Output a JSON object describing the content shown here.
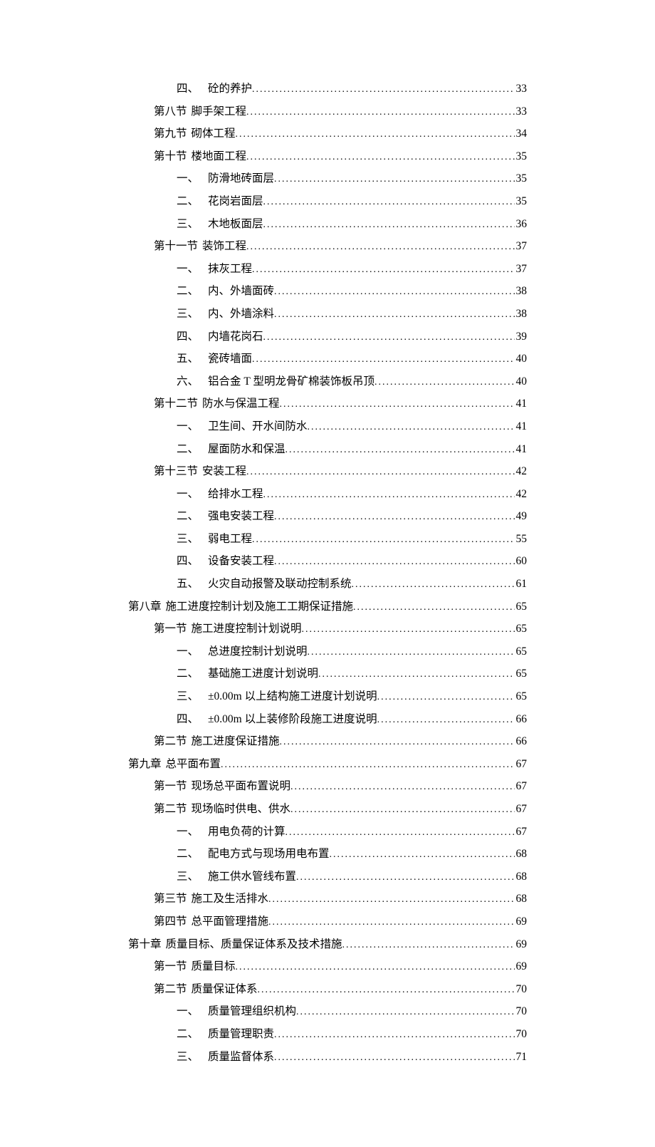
{
  "toc": [
    {
      "level": 2,
      "label": "四、",
      "title": "砼的养护",
      "page": "33"
    },
    {
      "level": 1,
      "label": "第八节",
      "title": "脚手架工程",
      "page": "33"
    },
    {
      "level": 1,
      "label": "第九节",
      "title": "砌体工程",
      "page": "34"
    },
    {
      "level": 1,
      "label": "第十节",
      "title": "楼地面工程",
      "page": "35"
    },
    {
      "level": 2,
      "label": "一、",
      "title": "防滑地砖面层",
      "page": "35"
    },
    {
      "level": 2,
      "label": "二、",
      "title": "花岗岩面层",
      "page": "35"
    },
    {
      "level": 2,
      "label": "三、",
      "title": "木地板面层",
      "page": "36"
    },
    {
      "level": 1,
      "label": "第十一节",
      "title": "装饰工程",
      "page": "37"
    },
    {
      "level": 2,
      "label": "一、",
      "title": "抹灰工程",
      "page": "37"
    },
    {
      "level": 2,
      "label": "二、",
      "title": "内、外墙面砖",
      "page": "38"
    },
    {
      "level": 2,
      "label": "三、",
      "title": "内、外墙涂料",
      "page": "38"
    },
    {
      "level": 2,
      "label": "四、",
      "title": "内墙花岗石",
      "page": "39"
    },
    {
      "level": 2,
      "label": "五、",
      "title": "瓷砖墙面",
      "page": "40"
    },
    {
      "level": 2,
      "label": "六、",
      "title": "铝合金 T 型明龙骨矿棉装饰板吊顶",
      "page": "40"
    },
    {
      "level": 1,
      "label": "第十二节",
      "title": "防水与保温工程",
      "page": "41"
    },
    {
      "level": 2,
      "label": "一、",
      "title": "卫生间、开水间防水",
      "page": "41"
    },
    {
      "level": 2,
      "label": "二、",
      "title": "屋面防水和保温",
      "page": "41"
    },
    {
      "level": 1,
      "label": "第十三节",
      "title": "安装工程",
      "page": "42"
    },
    {
      "level": 2,
      "label": "一、",
      "title": "给排水工程",
      "page": "42"
    },
    {
      "level": 2,
      "label": "二、",
      "title": "强电安装工程",
      "page": "49"
    },
    {
      "level": 2,
      "label": "三、",
      "title": "弱电工程",
      "page": "55"
    },
    {
      "level": 2,
      "label": "四、",
      "title": "设备安装工程",
      "page": "60"
    },
    {
      "level": 2,
      "label": "五、",
      "title": "火灾自动报警及联动控制系统",
      "page": "61"
    },
    {
      "level": 0,
      "label": "第八章",
      "title": "施工进度控制计划及施工工期保证措施",
      "page": "65"
    },
    {
      "level": 1,
      "label": "第一节",
      "title": "施工进度控制计划说明",
      "page": "65"
    },
    {
      "level": 2,
      "label": "一、",
      "title": "总进度控制计划说明",
      "page": "65"
    },
    {
      "level": 2,
      "label": "二、",
      "title": "基础施工进度计划说明",
      "page": "65"
    },
    {
      "level": 2,
      "label": "三、",
      "title": "±0.00m 以上结构施工进度计划说明",
      "page": "65"
    },
    {
      "level": 2,
      "label": "四、",
      "title": "±0.00m 以上装修阶段施工进度说明",
      "page": "66"
    },
    {
      "level": 1,
      "label": "第二节",
      "title": "施工进度保证措施",
      "page": "66"
    },
    {
      "level": 0,
      "label": "第九章",
      "title": "总平面布置",
      "page": "67"
    },
    {
      "level": 1,
      "label": "第一节",
      "title": "现场总平面布置说明",
      "page": "67"
    },
    {
      "level": 1,
      "label": "第二节",
      "title": "现场临时供电、供水",
      "page": "67"
    },
    {
      "level": 2,
      "label": "一、",
      "title": "用电负荷的计算",
      "page": "67"
    },
    {
      "level": 2,
      "label": "二、",
      "title": "配电方式与现场用电布置",
      "page": "68"
    },
    {
      "level": 2,
      "label": "三、",
      "title": "施工供水管线布置",
      "page": "68"
    },
    {
      "level": 1,
      "label": "第三节",
      "title": "施工及生活排水",
      "page": "68"
    },
    {
      "level": 1,
      "label": "第四节",
      "title": "总平面管理措施",
      "page": "69"
    },
    {
      "level": 0,
      "label": "第十章",
      "title": "质量目标、质量保证体系及技术措施",
      "page": "69"
    },
    {
      "level": 1,
      "label": "第一节",
      "title": "质量目标",
      "page": "69"
    },
    {
      "level": 1,
      "label": "第二节",
      "title": "质量保证体系",
      "page": "70"
    },
    {
      "level": 2,
      "label": "一、",
      "title": "质量管理组织机构",
      "page": "70"
    },
    {
      "level": 2,
      "label": "二、",
      "title": "质量管理职责",
      "page": "70"
    },
    {
      "level": 2,
      "label": "三、",
      "title": "质量监督体系",
      "page": "71"
    }
  ]
}
